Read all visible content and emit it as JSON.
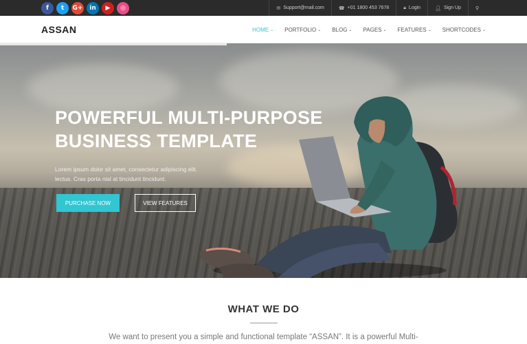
{
  "topbar": {
    "social": [
      {
        "name": "facebook-icon",
        "glyph": "f",
        "class": "s-fb"
      },
      {
        "name": "twitter-icon",
        "glyph": "t",
        "class": "s-tw"
      },
      {
        "name": "google-plus-icon",
        "glyph": "G+",
        "class": "s-gp"
      },
      {
        "name": "linkedin-icon",
        "glyph": "in",
        "class": "s-in"
      },
      {
        "name": "youtube-icon",
        "glyph": "▶",
        "class": "s-yt"
      },
      {
        "name": "dribbble-icon",
        "glyph": "◎",
        "class": "s-dr"
      }
    ],
    "email": "Support@mail.com",
    "phone": "+01 1800 453 7678",
    "login": "Login",
    "signup": "Sign Up"
  },
  "nav": {
    "logo": "ASSAN",
    "items": [
      {
        "label": "HOME",
        "active": true
      },
      {
        "label": "PORTFOLIO",
        "active": false
      },
      {
        "label": "BLOG",
        "active": false
      },
      {
        "label": "PAGES",
        "active": false
      },
      {
        "label": "FEATURES",
        "active": false
      },
      {
        "label": "SHORTCODES",
        "active": false
      }
    ]
  },
  "hero": {
    "title_line1": "POWERFUL MULTI-PURPOSE",
    "title_line2": "BUSINESS TEMPLATE",
    "text_line1": "Lorem ipsum dolor sit amet, consectetur adipiscing elit.",
    "text_line2": "lectus. Cras porta nisl at tincidunt tincidunt.",
    "primary_button": "PURCHASE NOW",
    "secondary_button": "VIEW FEATURES"
  },
  "section": {
    "title": "WHAT WE DO",
    "text": "We want to present you a simple and functional template “ASSAN”. It is a powerful Multi-"
  },
  "colors": {
    "accent": "#32c5d2",
    "topbar": "#2b2b2b"
  }
}
